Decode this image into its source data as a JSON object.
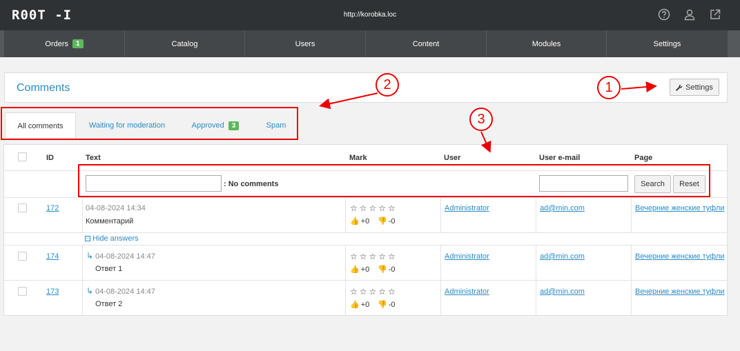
{
  "header": {
    "logo": "R00T -I",
    "site_url": "http://korobka.loc"
  },
  "icons": {
    "help": "question-circle-icon",
    "user": "user-icon",
    "external": "external-link-icon"
  },
  "nav": {
    "items": [
      {
        "label": "Orders",
        "badge": "1"
      },
      {
        "label": "Catalog"
      },
      {
        "label": "Users"
      },
      {
        "label": "Content"
      },
      {
        "label": "Modules"
      },
      {
        "label": "Settings"
      }
    ]
  },
  "panel": {
    "title": "Comments",
    "settings_label": "Settings"
  },
  "tabs": {
    "items": [
      {
        "label": "All comments"
      },
      {
        "label": "Waiting for moderation"
      },
      {
        "label": "Approved",
        "badge": "3"
      },
      {
        "label": "Spam"
      }
    ]
  },
  "table": {
    "columns": {
      "id": "ID",
      "text": "Text",
      "mark": "Mark",
      "user": "User",
      "email": "User e-mail",
      "page": "Page"
    },
    "filter": {
      "note": ": No comments",
      "search_label": "Search",
      "reset_label": "Reset"
    },
    "rows": [
      {
        "id": "172",
        "date": "04-08-2024 14:34",
        "text": "Комментарий",
        "stars": "☆☆☆☆☆",
        "up": "+0",
        "down": "-0",
        "user": "Administrator",
        "email": "ad@min.com",
        "page": "Вечерние женские туфли"
      },
      {
        "id": "174",
        "date": "04-08-2024 14:47",
        "text": "Ответ 1",
        "stars": "☆☆☆☆☆",
        "up": "+0",
        "down": "-0",
        "user": "Administrator",
        "email": "ad@min.com",
        "page": "Вечерние женские туфли"
      },
      {
        "id": "173",
        "date": "04-08-2024 14:47",
        "text": "Ответ 2",
        "stars": "☆☆☆☆☆",
        "up": "+0",
        "down": "-0",
        "user": "Administrator",
        "email": "ad@min.com",
        "page": "Вечерние женские туфли"
      }
    ],
    "hide_answers": "Hide answers"
  },
  "callouts": [
    "1",
    "2",
    "3"
  ],
  "colors": {
    "accent": "#2a8bc5",
    "badge": "#5cb85c",
    "annotation": "#e00000",
    "topbar": "#2f3234"
  }
}
